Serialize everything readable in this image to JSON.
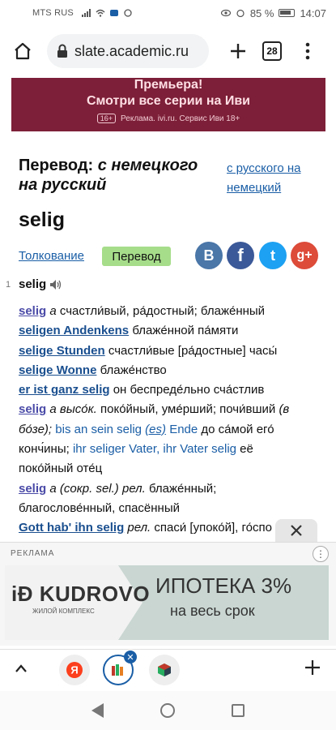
{
  "status": {
    "carrier": "MTS RUS",
    "battery": "85 %",
    "time": "14:07"
  },
  "browser": {
    "url": "slate.academic.ru",
    "tab_count": "28"
  },
  "ad_top": {
    "line1": "Премьера!",
    "line2": "Смотри все серии на Иви",
    "age": "16+",
    "disclaimer": "Реклама. ivi.ru. Сервис Иви 18+"
  },
  "heading": {
    "prefix": "Перевод:",
    "direction": "с немецкого на русский",
    "alt_direction": "с русского на немецкий"
  },
  "word": "selig",
  "tabs": {
    "tolkovanie": "Толкование",
    "perevod": "Перевод"
  },
  "social": {
    "vk": "B",
    "fb": "f",
    "tw": "t",
    "gp": "g+"
  },
  "entry": {
    "number": "1",
    "headword": "selig"
  },
  "entries": [
    {
      "kw": "selig",
      "gram": "a",
      "text": "счастли́вый, ра́достный; блаже́нный"
    },
    {
      "kw": "seligen Andenkens",
      "text": "блаже́нной па́мяти"
    },
    {
      "kw": "selige Stunden",
      "text": "счастли́вые [ра́достные] часы́"
    },
    {
      "kw": "selige Wonne",
      "text": "блаже́нство"
    },
    {
      "kw": "er ist ganz selig",
      "text": "он беспреде́льно сча́стлив"
    }
  ],
  "entry2": {
    "kw": "selig",
    "gram": "a высо́к.",
    "l1_text": "поко́йный, уме́рший; почи́вший",
    "l1_paren": "(в",
    "l2_paren": "бо́зе);",
    "l2_link1": "bis an sein selig",
    "l2_link2": "(es)",
    "l2_link3": "Ende",
    "l2_text": "до са́мой его́",
    "l3_text1": "конч́ины;",
    "l3_link1": "ihr seliger Vater, ihr Vater selig",
    "l3_text2": "её",
    "l4_text": "поко́йный оте́ц"
  },
  "entry3": {
    "kw": "selig",
    "gram": "a (сокр. sel.)",
    "label": "рел.",
    "l1_text": "блаже́нный;",
    "l2_text": "благослове́нный, спасённый"
  },
  "entry4": {
    "kw": "Gott hab' ihn selig",
    "label": "рел.",
    "text": "спаси́ [упоко́й], го́спо"
  },
  "ad_bottom": {
    "label": "РЕКЛАМА",
    "logo": "iÐ KUDROVO",
    "logo_sub": "ЖИЛОЙ КОМПЛЕКС",
    "headline": "ИПОТЕКА 3%",
    "subline": "на весь срок"
  }
}
